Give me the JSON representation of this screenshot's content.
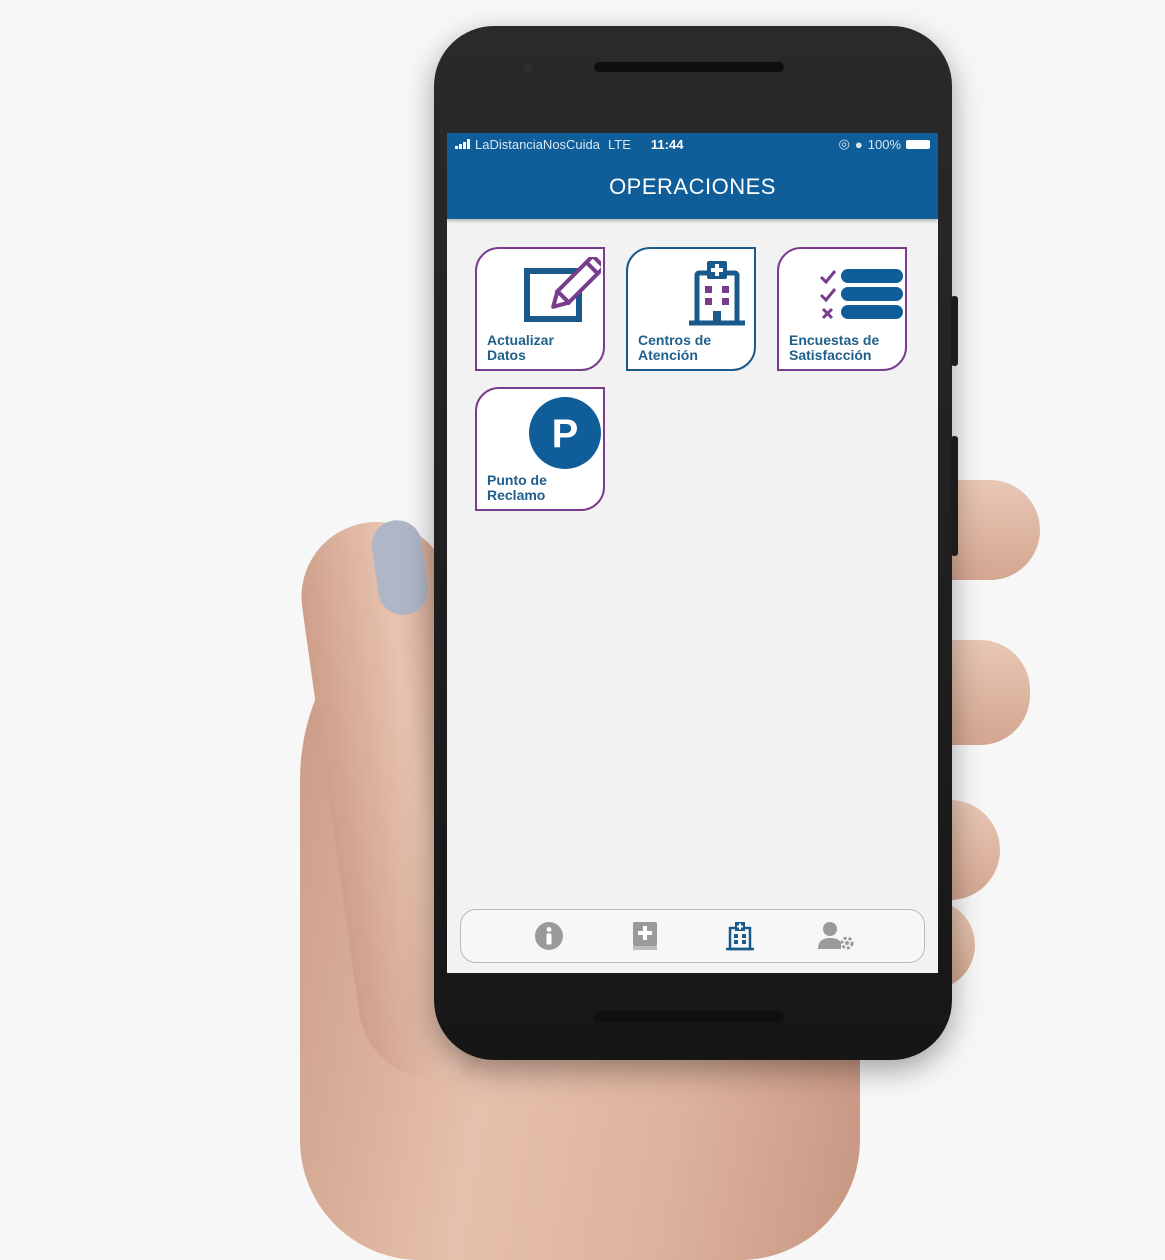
{
  "status_bar": {
    "carrier": "LaDistanciaNosCuida",
    "network": "LTE",
    "time": "11:44",
    "battery": "100%"
  },
  "header": {
    "title": "OPERACIONES"
  },
  "tiles": [
    {
      "label": "Actualizar\nDatos",
      "icon": "edit-icon"
    },
    {
      "label": "Centros de\nAtención",
      "icon": "hospital-icon"
    },
    {
      "label": "Encuestas de\nSatisfacción",
      "icon": "survey-list-icon"
    },
    {
      "label": "Punto de\nReclamo",
      "icon": "parking-p-icon"
    }
  ],
  "bottom_nav": [
    {
      "icon": "info-icon",
      "active": false
    },
    {
      "icon": "medical-book-icon",
      "active": false
    },
    {
      "icon": "hospital-icon",
      "active": true
    },
    {
      "icon": "user-settings-icon",
      "active": false
    }
  ],
  "colors": {
    "primary_blue": "#0f5d99",
    "tile_purple": "#7a3c8c",
    "label_blue": "#1f5f8b",
    "inactive_icon": "#9a9a9a"
  }
}
